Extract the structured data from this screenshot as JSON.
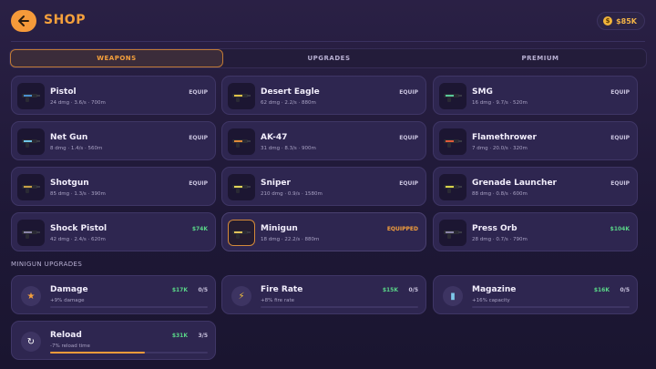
{
  "header": {
    "title": "SHOP",
    "coins": "$85K"
  },
  "tabs": [
    {
      "label": "WEAPONS",
      "active": true
    },
    {
      "label": "UPGRADES",
      "active": false
    },
    {
      "label": "PREMIUM",
      "active": false
    }
  ],
  "weapons": [
    {
      "name": "Pistol",
      "stats": "24 dmg · 3.6/s · 700m",
      "action": "EQUIP",
      "action_type": "equip",
      "icon": "pistol-icon",
      "color": "#4a8fd0"
    },
    {
      "name": "Desert Eagle",
      "stats": "62 dmg · 2.2/s · 880m",
      "action": "EQUIP",
      "action_type": "equip",
      "icon": "desert-eagle-icon",
      "color": "#e0c24a"
    },
    {
      "name": "SMG",
      "stats": "16 dmg · 9.7/s · 520m",
      "action": "EQUIP",
      "action_type": "equip",
      "icon": "smg-icon",
      "color": "#58c89a"
    },
    {
      "name": "Net Gun",
      "stats": "8 dmg · 1.4/s · 560m",
      "action": "EQUIP",
      "action_type": "equip",
      "icon": "net-gun-icon",
      "color": "#6fc6e8"
    },
    {
      "name": "AK-47",
      "stats": "31 dmg · 8.3/s · 900m",
      "action": "EQUIP",
      "action_type": "equip",
      "icon": "ak47-icon",
      "color": "#e08a3a"
    },
    {
      "name": "Flamethrower",
      "stats": "7 dmg · 20.0/s · 320m",
      "action": "EQUIP",
      "action_type": "equip",
      "icon": "flamethrower-icon",
      "color": "#e05a3a"
    },
    {
      "name": "Shotgun",
      "stats": "85 dmg · 1.3/s · 390m",
      "action": "EQUIP",
      "action_type": "equip",
      "icon": "shotgun-icon",
      "color": "#c8a048"
    },
    {
      "name": "Sniper",
      "stats": "210 dmg · 0.9/s · 1580m",
      "action": "EQUIP",
      "action_type": "equip",
      "icon": "sniper-icon",
      "color": "#e2d45a"
    },
    {
      "name": "Grenade Launcher",
      "stats": "88 dmg · 0.8/s · 600m",
      "action": "EQUIP",
      "action_type": "equip",
      "icon": "grenade-launcher-icon",
      "color": "#d8d24a"
    },
    {
      "name": "Shock Pistol",
      "stats": "42 dmg · 2.4/s · 620m",
      "action": "$74K",
      "action_type": "price",
      "icon": "shock-pistol-icon",
      "color": "#8a84a8"
    },
    {
      "name": "Minigun",
      "stats": "18 dmg · 22.2/s · 880m",
      "action": "EQUIPPED",
      "action_type": "equipped",
      "icon": "minigun-icon",
      "color": "#e2c25a"
    },
    {
      "name": "Press Orb",
      "stats": "28 dmg · 0.7/s · 790m",
      "action": "$104K",
      "action_type": "price",
      "icon": "press-orb-icon",
      "color": "#8a84a8"
    }
  ],
  "upgrades_title": "MINIGUN UPGRADES",
  "upgrades": [
    {
      "name": "Damage",
      "desc": "+9% damage",
      "price": "$17K",
      "level": "0/5",
      "progress": 0,
      "icon": "star-icon",
      "glyph": "★",
      "glyph_color": "#f5a03c"
    },
    {
      "name": "Fire Rate",
      "desc": "+8% fire rate",
      "price": "$15K",
      "level": "0/5",
      "progress": 0,
      "icon": "lightning-icon",
      "glyph": "⚡",
      "glyph_color": "#f5c23c"
    },
    {
      "name": "Magazine",
      "desc": "+16% capacity",
      "price": "$16K",
      "level": "0/5",
      "progress": 0,
      "icon": "magazine-icon",
      "glyph": "▮",
      "glyph_color": "#7ec8ea"
    },
    {
      "name": "Reload",
      "desc": "-7% reload time",
      "price": "$31K",
      "level": "3/5",
      "progress": 0.6,
      "icon": "reload-icon",
      "glyph": "↻",
      "glyph_color": "#ffffff"
    }
  ]
}
